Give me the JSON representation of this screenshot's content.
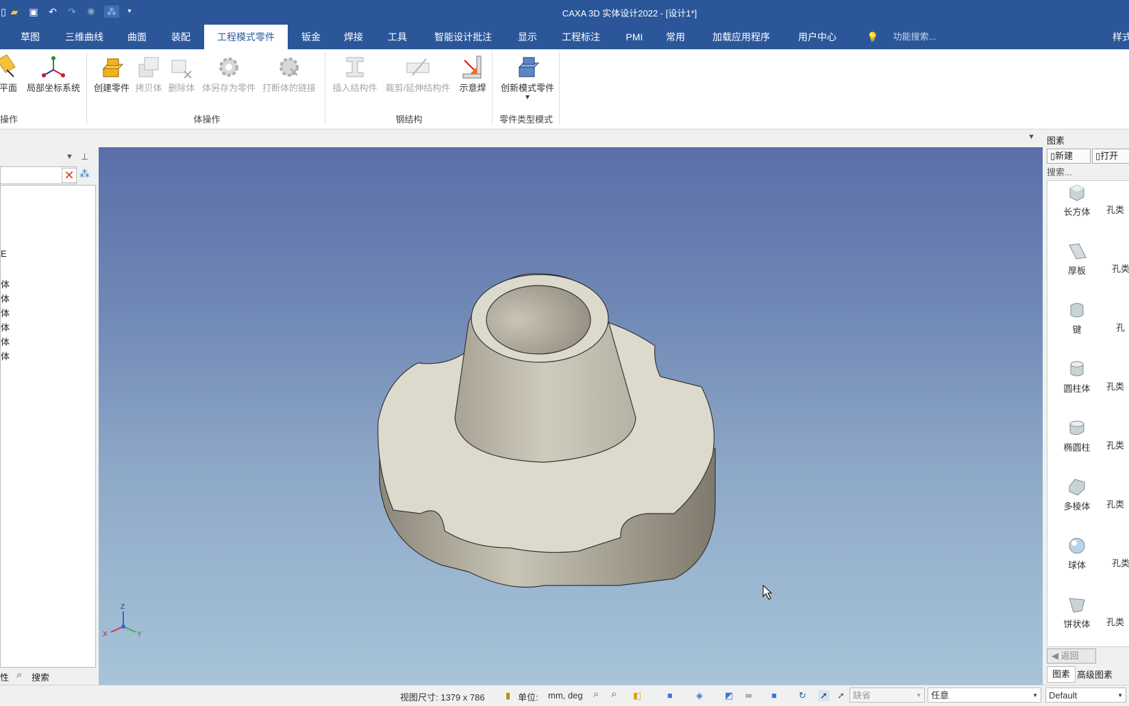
{
  "window": {
    "title": "CAXA 3D 实体设计2022 - [设计1*]"
  },
  "quick_access": {
    "icons": [
      "new-icon",
      "open-folder-icon",
      "save-icon",
      "undo-icon",
      "redo-icon",
      "gear-icon",
      "sparkle-icon",
      "dropdown-icon"
    ]
  },
  "tabs": [
    {
      "label": "草图"
    },
    {
      "label": "三维曲线"
    },
    {
      "label": "曲面"
    },
    {
      "label": "装配"
    },
    {
      "label": "工程模式零件"
    },
    {
      "label": "钣金"
    },
    {
      "label": "焊接"
    },
    {
      "label": "工具"
    },
    {
      "label": "智能设计批注"
    },
    {
      "label": "显示"
    },
    {
      "label": "工程标注"
    },
    {
      "label": "PMI"
    },
    {
      "label": "常用"
    },
    {
      "label": "加载应用程序"
    },
    {
      "label": "用户中心"
    }
  ],
  "function_search": "功能搜索...",
  "style_tab": "样式",
  "ribbon": {
    "buttons": {
      "plane": "平面",
      "local_cs": "局部坐标系统",
      "create_part": "创建零件",
      "copy_body": "拷贝体",
      "delete_body": "删除体",
      "save_as_part": "体另存为零件",
      "break_link": "打断体的链接",
      "insert_struct": "插入结构件",
      "trim_extend": "裁剪/延伸结构件",
      "weld_symbol": "示意焊",
      "new_mode_part": "创新模式零件"
    },
    "groups": {
      "ops": "操作",
      "body_ops": "体操作",
      "steel": "钢结构",
      "part_type": "零件类型模式"
    }
  },
  "tree": {
    "items": [
      "E",
      "体",
      "体",
      "体",
      "体",
      "体",
      "体"
    ]
  },
  "left_tabs": {
    "props": "性",
    "search": "搜索"
  },
  "right_panel": {
    "title": "图素",
    "new_button": "新建",
    "open_button": "打开",
    "search_placeholder": "搜索...",
    "items": [
      {
        "label": "长方体",
        "icon": "box-icon"
      },
      {
        "label": "厚板",
        "icon": "plate-icon"
      },
      {
        "label": "键",
        "icon": "key-icon"
      },
      {
        "label": "圆柱体",
        "icon": "cylinder-icon"
      },
      {
        "label": "椭圆柱",
        "icon": "elliptic-cylinder-icon"
      },
      {
        "label": "多棱体",
        "icon": "prism-icon"
      },
      {
        "label": "球体",
        "icon": "sphere-icon"
      },
      {
        "label": "饼状体",
        "icon": "pie-icon"
      }
    ],
    "side_items": [
      "孔类",
      "孔类",
      "孔",
      "孔类",
      "孔类",
      "孔类",
      "孔类",
      "孔类"
    ],
    "back_button": "返回",
    "bottom_tabs": [
      "图素",
      "高级图素"
    ]
  },
  "axis": {
    "z": "Z",
    "x": "X",
    "y": "Y"
  },
  "status": {
    "view_size": "视图尺寸: 1379 x  786",
    "unit_label": "单位:",
    "unit_value": "mm, deg",
    "default_combo": "缺省",
    "any_combo": "任意",
    "profile_combo": "Default"
  }
}
